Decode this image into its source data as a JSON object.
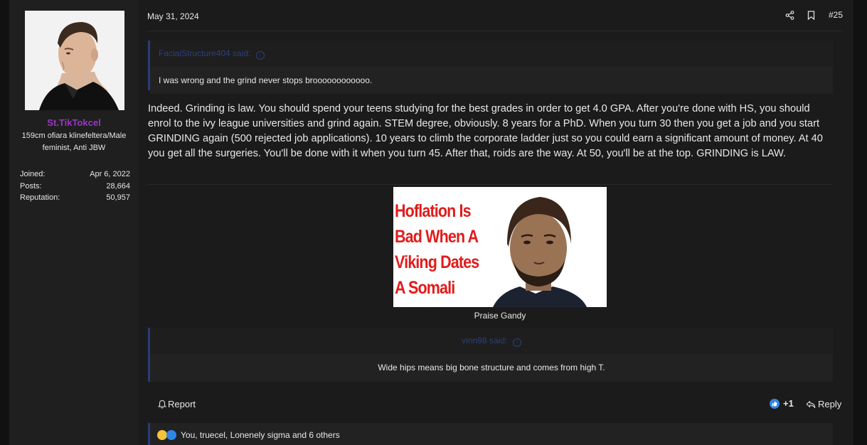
{
  "user": {
    "name": "St.TikTokcel",
    "title": "159cm ofiara klinefeltera/Male feminist, Anti JBW",
    "stats": [
      {
        "label": "Joined:",
        "value": "Apr 6, 2022"
      },
      {
        "label": "Posts:",
        "value": "28,664"
      },
      {
        "label": "Reputation:",
        "value": "50,957"
      }
    ]
  },
  "post": {
    "date": "May 31, 2024",
    "number": "#25",
    "quote1": {
      "author": "FacialStructure404 said:",
      "text": "I was wrong and the grind never stops broooooooooooo."
    },
    "message": "Indeed. Grinding is law. You should spend your teens studying for the best grades in order to get 4.0 GPA. After you're done with HS, you should enrol to the ivy league universities and grind again. STEM degree, obviously. 8 years for a PhD. When you turn 30 then you get a job and you start GRINDING again (500 rejected job applications). 10 years to climb the corporate ladder just so you could earn a significant amount of money. At 40 you get all the surgeries. You'll be done with it when you turn 45. After that, roids are the way. At 50, you'll be at the top. GRINDING is LAW.",
    "image_text": [
      "Hoflation Is",
      "Bad When A",
      "Viking Dates",
      "A Somali"
    ],
    "caption": "Praise Gandy",
    "quote2": {
      "author": "vinn98 said:",
      "text": "Wide hips means big bone structure and comes from high T."
    },
    "report_label": "Report",
    "react_count": "+1",
    "reply_label": "Reply",
    "reactions_text": "You, truecel, Lonenely sigma and 6 others"
  },
  "colors": {
    "username": "#9b36c4",
    "quote_author": "#2e3f7e",
    "meme_text": "#e11b1b"
  }
}
